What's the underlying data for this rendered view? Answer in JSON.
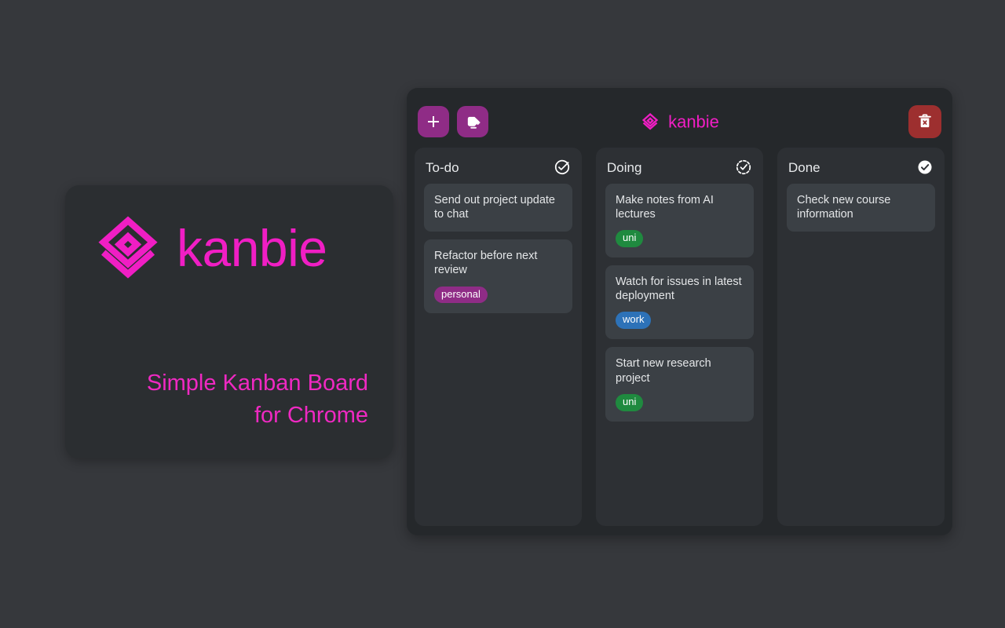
{
  "promo": {
    "logo_icon": "kanbie-stack-logo",
    "wordmark": "kanbie",
    "tagline": "Simple Kanban Board for Chrome",
    "tagline_line1": "Simple Kanban Board",
    "tagline_line2": "for Chrome",
    "accent_color": "#f01ec4",
    "card_background": "#2b2e31"
  },
  "board": {
    "background": "#25282b",
    "brand": {
      "icon": "kanbie-stack-logo",
      "label": "kanbie",
      "color": "#f01ec4"
    },
    "toolbar": {
      "add_label": "+",
      "add_icon": "plus-icon",
      "add_title": "Add task",
      "tags_icon": "tags-icon",
      "tags_title": "Manage tags",
      "delete_icon": "trash-x-icon",
      "delete_title": "Delete board",
      "button_color": "#8f2c86",
      "danger_color": "#9d2f2f"
    },
    "columns": [
      {
        "id": "todo",
        "title": "To-do",
        "icon": "circle-check-outline-icon",
        "cards": [
          {
            "text": "Send out project update to chat",
            "tags": []
          },
          {
            "text": "Refactor before next review",
            "tags": [
              {
                "label": "personal",
                "color": "#8f2c86"
              }
            ]
          }
        ]
      },
      {
        "id": "doing",
        "title": "Doing",
        "icon": "circle-check-dashed-icon",
        "cards": [
          {
            "text": "Make notes from AI lectures",
            "tags": [
              {
                "label": "uni",
                "color": "#1f8a3f"
              }
            ]
          },
          {
            "text": "Watch for issues in latest deployment",
            "tags": [
              {
                "label": "work",
                "color": "#2d72b8"
              }
            ]
          },
          {
            "text": "Start new research project",
            "tags": [
              {
                "label": "uni",
                "color": "#1f8a3f"
              }
            ]
          }
        ]
      },
      {
        "id": "done",
        "title": "Done",
        "icon": "circle-check-filled-icon",
        "cards": [
          {
            "text": "Check new course information",
            "tags": []
          }
        ]
      }
    ]
  }
}
